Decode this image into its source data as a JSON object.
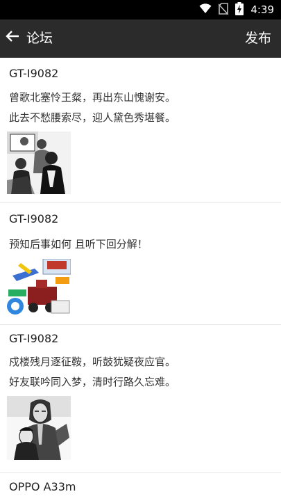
{
  "status_bar": {
    "time": "4:39",
    "icons": [
      "wifi-icon",
      "no-sim-icon",
      "battery-charging-icon"
    ]
  },
  "app_bar": {
    "back_icon": "arrow-left-icon",
    "title": "论坛",
    "action_label": "发布"
  },
  "posts": [
    {
      "author": "GT-I9082",
      "lines": [
        "曾歌北塞怜王粲，再出东山愧谢安。",
        "此去不愁腰索尽，迎人黛色秀堪餐。"
      ],
      "image": "comic-illustration-people-icon"
    },
    {
      "author": "GT-I9082",
      "lines": [
        "预知后事如何 且听下回分解！"
      ],
      "image": "toy-train-photo-icon"
    },
    {
      "author": "GT-I9082",
      "lines": [
        "戍楼残月逐征鞍，听鼓犹疑夜应官。",
        "好友联吟同入梦，清时行路久忘难。"
      ],
      "image": "sketch-portrait-woman-child-icon"
    },
    {
      "author": "OPPO A33m",
      "lines": [],
      "image": ""
    }
  ]
}
